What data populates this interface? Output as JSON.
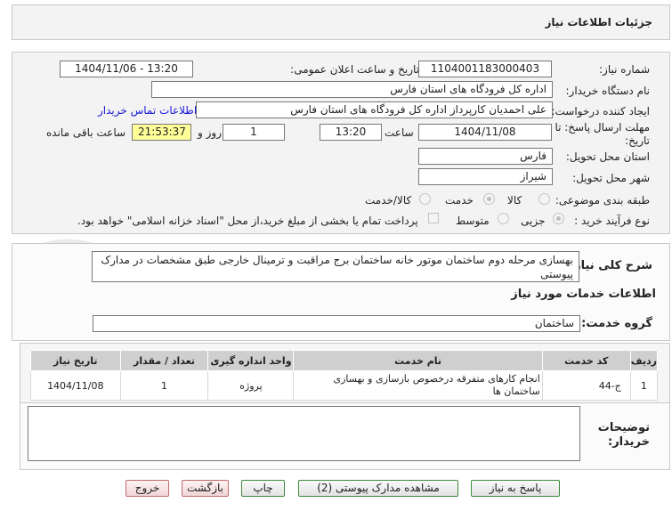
{
  "window": {
    "title": "جزئیات اطلاعات نیاز"
  },
  "form": {
    "need_number": {
      "label": "شماره نیاز:",
      "value": "1104001183000403"
    },
    "announce_datetime": {
      "label": "تاریخ و ساعت اعلان عمومی:",
      "value": "1404/11/06 - 13:20"
    },
    "buyer_org": {
      "label": "نام دستگاه خریدار:",
      "value": "اداره کل فرودگاه های استان فارس"
    },
    "creator": {
      "label": "ایجاد کننده درخواست:",
      "value": "علی  احمدیان کارپرداز اداره کل فرودگاه های استان فارس",
      "contact_link": "اطلاعات تماس خریدار"
    },
    "deadline": {
      "label": "مهلت ارسال پاسخ: تا تاریخ:",
      "date": "1404/11/08",
      "time_label": "ساعت",
      "time": "13:20",
      "days": "1",
      "days_label": "روز و",
      "remaining": "21:53:37",
      "remaining_label": "ساعت باقی مانده"
    },
    "province": {
      "label": "استان محل تحویل:",
      "value": "فارس"
    },
    "city": {
      "label": "شهر محل تحویل:",
      "value": "شیراز"
    },
    "category": {
      "label": "طبقه بندی موضوعی:",
      "options": [
        "کالا",
        "خدمت",
        "کالا/خدمت"
      ],
      "selected": "خدمت"
    },
    "process": {
      "label": "نوع فرآیند خرید :",
      "options": [
        "جزیی",
        "متوسط"
      ],
      "selected": "جزیی",
      "payment_note": "پرداخت تمام یا بخشی از مبلغ خرید،از محل \"اسناد خزانه اسلامی\" خواهد بود."
    }
  },
  "need_summary": {
    "label": "شرح کلی نیاز:",
    "value": "بهسازی مرحله دوم ساختمان موتور خانه ساختمان برج مراقبت و ترمینال خارجی طبق مشخصات در مدارک پیوستی"
  },
  "services": {
    "heading": "اطلاعات خدمات مورد نیاز",
    "group_label": "گروه خدمت:",
    "group_value": "ساختمان",
    "columns": [
      "ردیف",
      "کد خدمت",
      "نام خدمت",
      "واحد اندازه گیری",
      "تعداد / مقدار",
      "تاریخ نیاز"
    ],
    "rows": [
      {
        "row": "1",
        "code": "ج-44",
        "name": "انجام کارهای متفرقه درخصوص بازسازی و بهسازی ساختمان ها",
        "unit": "پروژه",
        "qty": "1",
        "date": "1404/11/08"
      }
    ]
  },
  "buyer_notes": {
    "label": "توضیحات خریدار:",
    "value": ""
  },
  "buttons": {
    "reply": "پاسخ به نیاز",
    "attachments": "مشاهده مدارک پیوستی (2)",
    "print": "چاپ",
    "back": "بازگشت",
    "exit": "خروج"
  },
  "watermark": {
    "text": "AriaTender.net"
  },
  "colors": {
    "link": "#1a1ad6",
    "remaining_bg": "#ffff99",
    "button_border": "#3d8a3d",
    "red_button_bg": "#f0d6d6"
  }
}
